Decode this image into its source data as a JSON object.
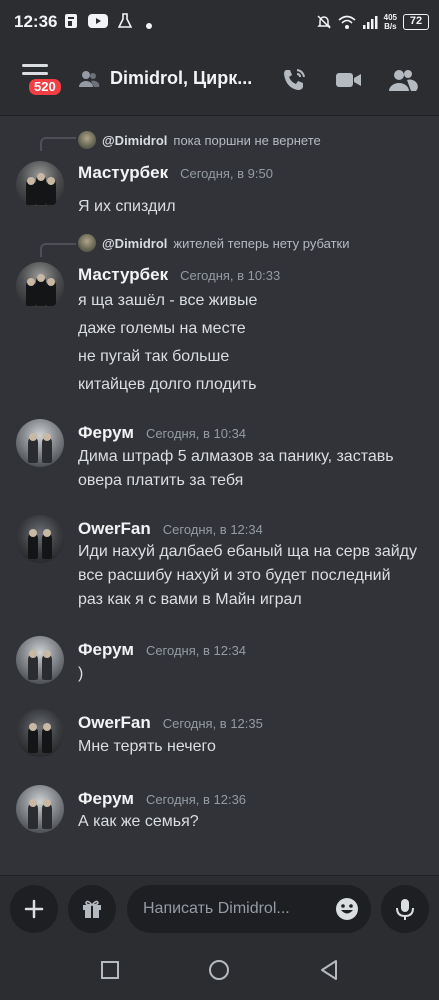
{
  "status_bar": {
    "time": "12:36",
    "net_speed_top": "405",
    "net_speed_bottom": "B/s",
    "battery": "72"
  },
  "header": {
    "unread_badge": "520",
    "channel_title": "Dimidrol, Цирк..."
  },
  "messages": [
    {
      "reply": {
        "name": "@Dimidrol",
        "text": "пока поршни не вернете"
      },
      "author": "Мастурбек",
      "time": "Сегодня, в 9:50",
      "lines": [
        "Я их спиздил"
      ]
    },
    {
      "reply": {
        "name": "@Dimidrol",
        "text": "жителей теперь нету рубатки"
      },
      "author": "Мастурбек",
      "time": "Сегодня, в 10:33",
      "lines": [
        "я ща зашёл - все живые",
        "даже големы на месте",
        "не пугай так больше",
        "китайцев долго плодить"
      ]
    },
    {
      "author": "Ферум",
      "time": "Сегодня, в 10:34",
      "lines": [
        "Дима штраф 5 алмазов за панику, заставь",
        "овера платить за тебя"
      ]
    },
    {
      "author": "OwerFan",
      "time": "Сегодня, в 12:34",
      "lines": [
        "Иди нахуй далбаеб ебаный ща на серв зайду",
        "все расшибу нахуй и это будет последний",
        "раз как я с вами в Майн играл"
      ]
    },
    {
      "author": "Ферум",
      "time": "Сегодня, в 12:34",
      "lines": [
        ")"
      ]
    },
    {
      "author": "OwerFan",
      "time": "Сегодня, в 12:35",
      "lines": [
        "Мне терять нечего"
      ]
    },
    {
      "author": "Ферум",
      "time": "Сегодня, в 12:36",
      "lines": [
        "А как же семья?"
      ]
    }
  ],
  "composer": {
    "placeholder": "Написать Dimidrol..."
  },
  "colors": {
    "background": "#313338",
    "surface": "#2b2d31",
    "badge": "#f23f43"
  }
}
